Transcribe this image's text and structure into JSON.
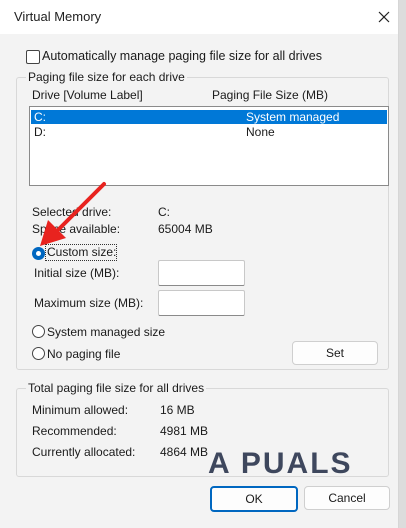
{
  "window": {
    "title": "Virtual Memory"
  },
  "auto_manage": {
    "label": "Automatically manage paging file size for all drives",
    "checked": false
  },
  "drives_group": {
    "title": "Paging file size for each drive",
    "col_drive": "Drive  [Volume Label]",
    "col_size": "Paging File Size (MB)",
    "rows": [
      {
        "drive": "C:",
        "size": "System managed",
        "selected": true
      },
      {
        "drive": "D:",
        "size": "None",
        "selected": false
      }
    ],
    "selected_drive_label": "Selected drive:",
    "selected_drive_value": "C:",
    "space_available_label": "Space available:",
    "space_available_value": "65004 MB",
    "custom_size_label": "Custom size:",
    "initial_size_label": "Initial size (MB):",
    "initial_size_value": "",
    "maximum_size_label": "Maximum size (MB):",
    "maximum_size_value": "",
    "system_managed_label": "System managed size",
    "no_paging_label": "No paging file",
    "set_label": "Set",
    "selected_option": "Custom size"
  },
  "totals_group": {
    "title": "Total paging file size for all drives",
    "minimum_label": "Minimum allowed:",
    "minimum_value": "16 MB",
    "recommended_label": "Recommended:",
    "recommended_value": "4981 MB",
    "currently_label": "Currently allocated:",
    "currently_value": "4864 MB"
  },
  "buttons": {
    "ok": "OK",
    "cancel": "Cancel"
  },
  "watermark": {
    "text": "A PUALS"
  },
  "colors": {
    "accent": "#0067c0",
    "selection": "#0078d7",
    "annotation_arrow": "#e8231f"
  }
}
